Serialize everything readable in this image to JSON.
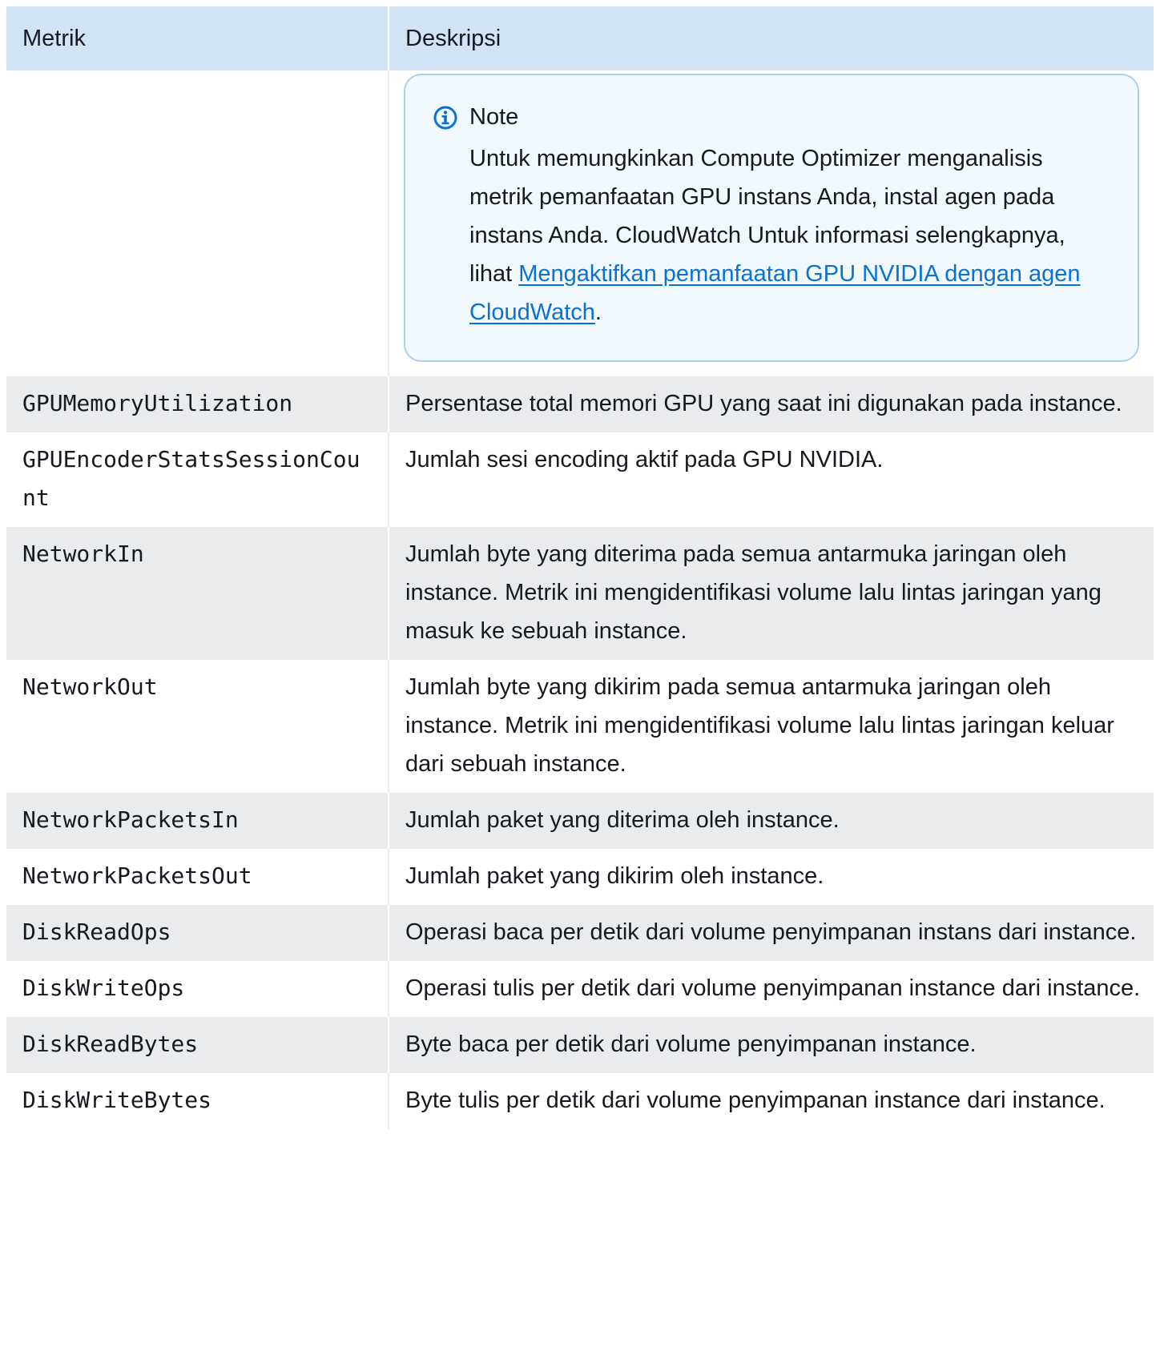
{
  "table": {
    "headers": {
      "metric": "Metrik",
      "description": "Deskripsi"
    },
    "note": {
      "title": "Note",
      "text_before_link": "Untuk memungkinkan Compute Optimizer menganalisis metrik pemanfaatan GPU instans Anda, instal agen pada instans Anda. CloudWatch Untuk informasi selengkapnya, lihat ",
      "link_text": "Mengaktifkan pemanfaatan GPU NVIDIA dengan agen CloudWatch",
      "text_after_link": "."
    },
    "rows": [
      {
        "metric": "GPUMemoryUtilization",
        "description": "Persentase total memori GPU yang saat ini digunakan pada instance."
      },
      {
        "metric": "GPUEncoderStatsSessionCount",
        "description": "Jumlah sesi encoding aktif pada GPU NVIDIA."
      },
      {
        "metric": "NetworkIn",
        "description": "Jumlah byte yang diterima pada semua antarmuka jaringan oleh instance. Metrik ini mengidentifikasi volume lalu lintas jaringan yang masuk ke sebuah instance."
      },
      {
        "metric": "NetworkOut",
        "description": "Jumlah byte yang dikirim pada semua antarmuka jaringan oleh instance. Metrik ini mengidentifikasi volume lalu lintas jaringan keluar dari sebuah instance."
      },
      {
        "metric": "NetworkPacketsIn",
        "description": "Jumlah paket yang diterima oleh instance."
      },
      {
        "metric": "NetworkPacketsOut",
        "description": "Jumlah paket yang dikirim oleh instance."
      },
      {
        "metric": "DiskReadOps",
        "description": "Operasi baca per detik dari volume penyimpanan instans dari instance."
      },
      {
        "metric": "DiskWriteOps",
        "description": "Operasi tulis per detik dari volume penyimpanan instance dari instance."
      },
      {
        "metric": "DiskReadBytes",
        "description": "Byte baca per detik dari volume penyimpanan instance."
      },
      {
        "metric": "DiskWriteBytes",
        "description": "Byte tulis per detik dari volume penyimpanan instance dari instance."
      }
    ]
  },
  "colors": {
    "header_bg": "#d1e4f6",
    "alt_row_bg": "#e9ebed",
    "note_bg": "#f1f8fe",
    "note_border": "#a9d0f0",
    "link": "#0972d3",
    "info_icon": "#0972d3"
  },
  "icons": {
    "note_icon": "info-circle-icon"
  }
}
